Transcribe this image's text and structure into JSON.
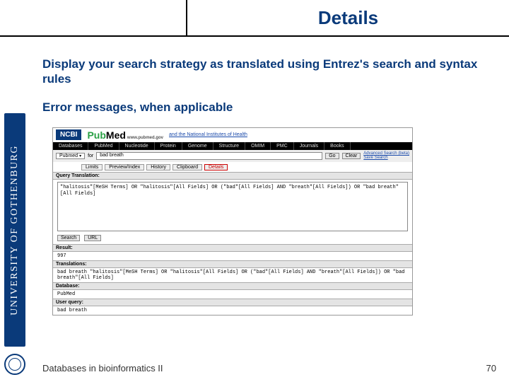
{
  "title": "Details",
  "body1": "Display your search strategy as translated using Entrez's search and syntax rules",
  "body2": "Error messages, when applicable",
  "sidebar": "UNIVERSITY OF GOTHENBURG",
  "footer_left": "Databases in bioinformatics II",
  "footer_right": "70",
  "ss": {
    "ncbi": "NCBI",
    "pubmed_pub": "Pub",
    "pubmed_med": "Med",
    "pubmed_url": "www.pubmed.gov",
    "nih": "and the National Institutes of Health",
    "tabs": [
      "Databases",
      "PubMed",
      "Nucleotide",
      "Protein",
      "Genome",
      "Structure",
      "OMIM",
      "PMC",
      "Journals",
      "Books"
    ],
    "search_label": "Pubmed",
    "search_for": "for",
    "search_value": "bad breath",
    "go": "Go",
    "clear": "Clear",
    "adv": "Advanced Search (beta)",
    "save": "Save Search",
    "subtabs": [
      "Limits",
      "Preview/Index",
      "History",
      "Clipboard",
      "Details"
    ],
    "qt_head": "Query Translation:",
    "qt_body": "\"halitosis\"[MeSH Terms] OR \"halitosis\"[All Fields] OR (\"bad\"[All Fields] AND \"breath\"[All Fields]) OR \"bad breath\"[All Fields]",
    "btn_search": "Search",
    "btn_url": "URL",
    "result_head": "Result:",
    "result_body": "997",
    "trans_head": "Translations:",
    "trans_body": "bad breath \"halitosis\"[MeSH Terms] OR \"halitosis\"[All Fields] OR (\"bad\"[All Fields] AND \"breath\"[All Fields]) OR \"bad breath\"[All Fields]",
    "db_head": "Database:",
    "db_body": "PubMed",
    "uq_head": "User query:",
    "uq_body": "bad breath"
  }
}
